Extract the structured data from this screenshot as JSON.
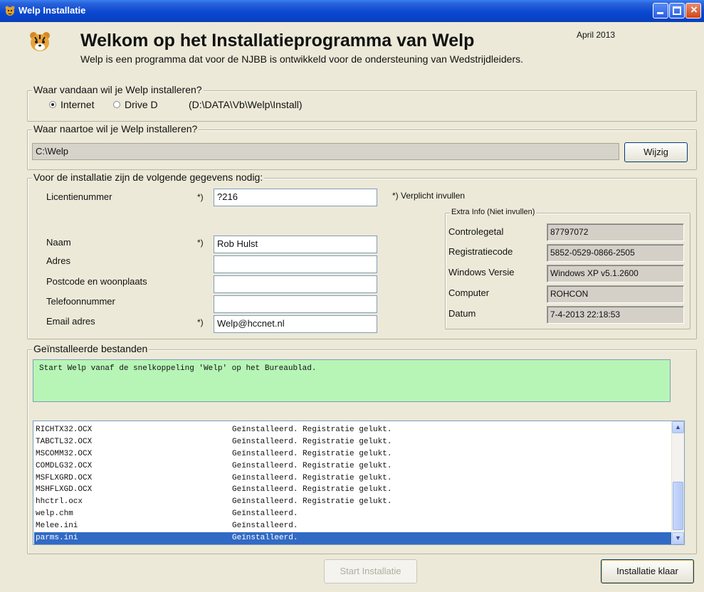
{
  "window": {
    "title": "Welp Installatie",
    "app_icon": "tiger-icon"
  },
  "header": {
    "title": "Welkom op het Installatieprogramma van Welp",
    "date": "April 2013",
    "subtitle": "Welp is een programma dat voor de NJBB is ontwikkeld voor de ondersteuning van Wedstrijdleiders."
  },
  "source": {
    "legend": "Waar vandaan wil je Welp installeren?",
    "options": [
      {
        "label": "Internet",
        "selected": true
      },
      {
        "label": "Drive D",
        "selected": false
      }
    ],
    "path": "(D:\\DATA\\Vb\\Welp\\Install)"
  },
  "destination": {
    "legend": "Waar naartoe wil je Welp installeren?",
    "path": "C:\\Welp",
    "change_button": "Wijzig"
  },
  "details": {
    "legend": "Voor de installatie zijn de volgende gegevens nodig:",
    "required_marker": "*)",
    "required_note": "*) Verplicht invullen",
    "fields": [
      {
        "label": "Licentienummer",
        "value": "?216",
        "required": true
      },
      {
        "label": "Naam",
        "value": "Rob Hulst",
        "required": true
      },
      {
        "label": "Adres",
        "value": "",
        "required": false
      },
      {
        "label": "Postcode en woonplaats",
        "value": "",
        "required": false
      },
      {
        "label": "Telefoonnummer",
        "value": "",
        "required": false
      },
      {
        "label": "Email adres",
        "value": "Welp@hccnet.nl",
        "required": true
      }
    ],
    "extra": {
      "legend": "Extra Info (Niet invullen)",
      "rows": [
        {
          "label": "Controlegetal",
          "value": "87797072"
        },
        {
          "label": "Registratiecode",
          "value": "5852-0529-0866-2505"
        },
        {
          "label": "Windows Versie",
          "value": "Windows XP v5.1.2600"
        },
        {
          "label": "Computer",
          "value": "ROHCON"
        },
        {
          "label": "Datum",
          "value": "7-4-2013 22:18:53"
        }
      ]
    }
  },
  "installed": {
    "legend": "Geïnstalleerde bestanden",
    "message": "Start Welp vanaf de snelkoppeling 'Welp' op het Bureaublad.",
    "files": [
      {
        "name": "RICHTX32.OCX",
        "status": "Geïnstalleerd. Registratie gelukt."
      },
      {
        "name": "TABCTL32.OCX",
        "status": "Geïnstalleerd. Registratie gelukt."
      },
      {
        "name": "MSCOMM32.OCX",
        "status": "Geïnstalleerd. Registratie gelukt."
      },
      {
        "name": "COMDLG32.OCX",
        "status": "Geïnstalleerd. Registratie gelukt."
      },
      {
        "name": "MSFLXGRD.OCX",
        "status": "Geïnstalleerd. Registratie gelukt."
      },
      {
        "name": "MSHFLXGD.OCX",
        "status": "Geïnstalleerd. Registratie gelukt."
      },
      {
        "name": "hhctrl.ocx",
        "status": "Geïnstalleerd. Registratie gelukt."
      },
      {
        "name": "welp.chm",
        "status": "Geïnstalleerd."
      },
      {
        "name": "Melee.ini",
        "status": "Geïnstalleerd."
      },
      {
        "name": "parms.ini",
        "status": "Geïnstalleerd.",
        "selected": true
      }
    ]
  },
  "buttons": {
    "start": "Start Installatie",
    "done": "Installatie klaar"
  },
  "colors": {
    "titlebar": "#0a48d0",
    "selection": "#316ac5",
    "message_bg": "#b7f5b7",
    "face": "#ece9d8"
  }
}
